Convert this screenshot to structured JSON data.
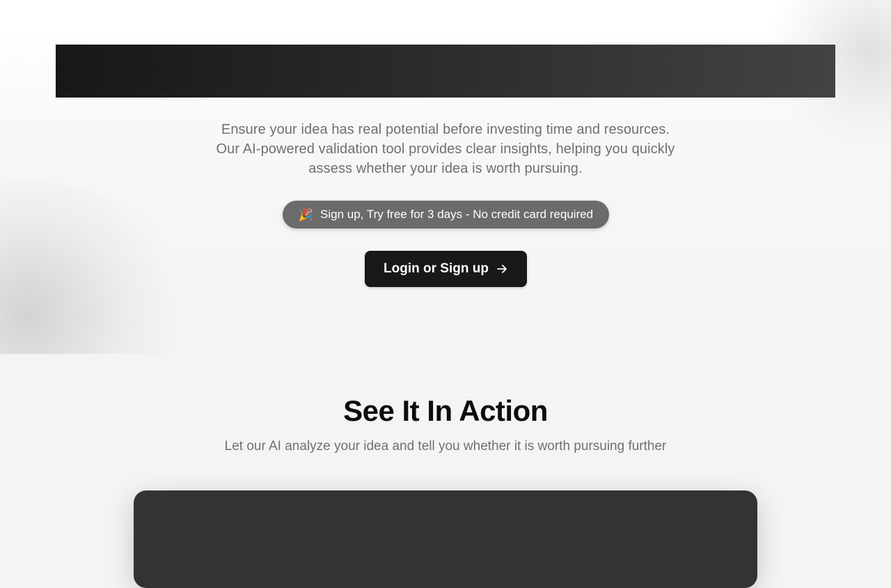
{
  "hero": {
    "description": "Ensure your idea has real potential before investing time and resources. Our AI-powered validation tool provides clear insights, helping you quickly assess whether your idea is worth pursuing.",
    "promo": {
      "emoji": "🎉",
      "text": "Sign up, Try free for 3 days - No credit card required"
    },
    "cta": {
      "label": "Login or Sign up",
      "icon": "arrow-right-icon"
    }
  },
  "section": {
    "title": "See It In Action",
    "subtitle": "Let our AI analyze your idea and tell you whether it is worth pursuing further"
  },
  "colors": {
    "cta_background": "#181818",
    "promo_background": "#6b6b6b",
    "demo_frame": "#333333"
  }
}
